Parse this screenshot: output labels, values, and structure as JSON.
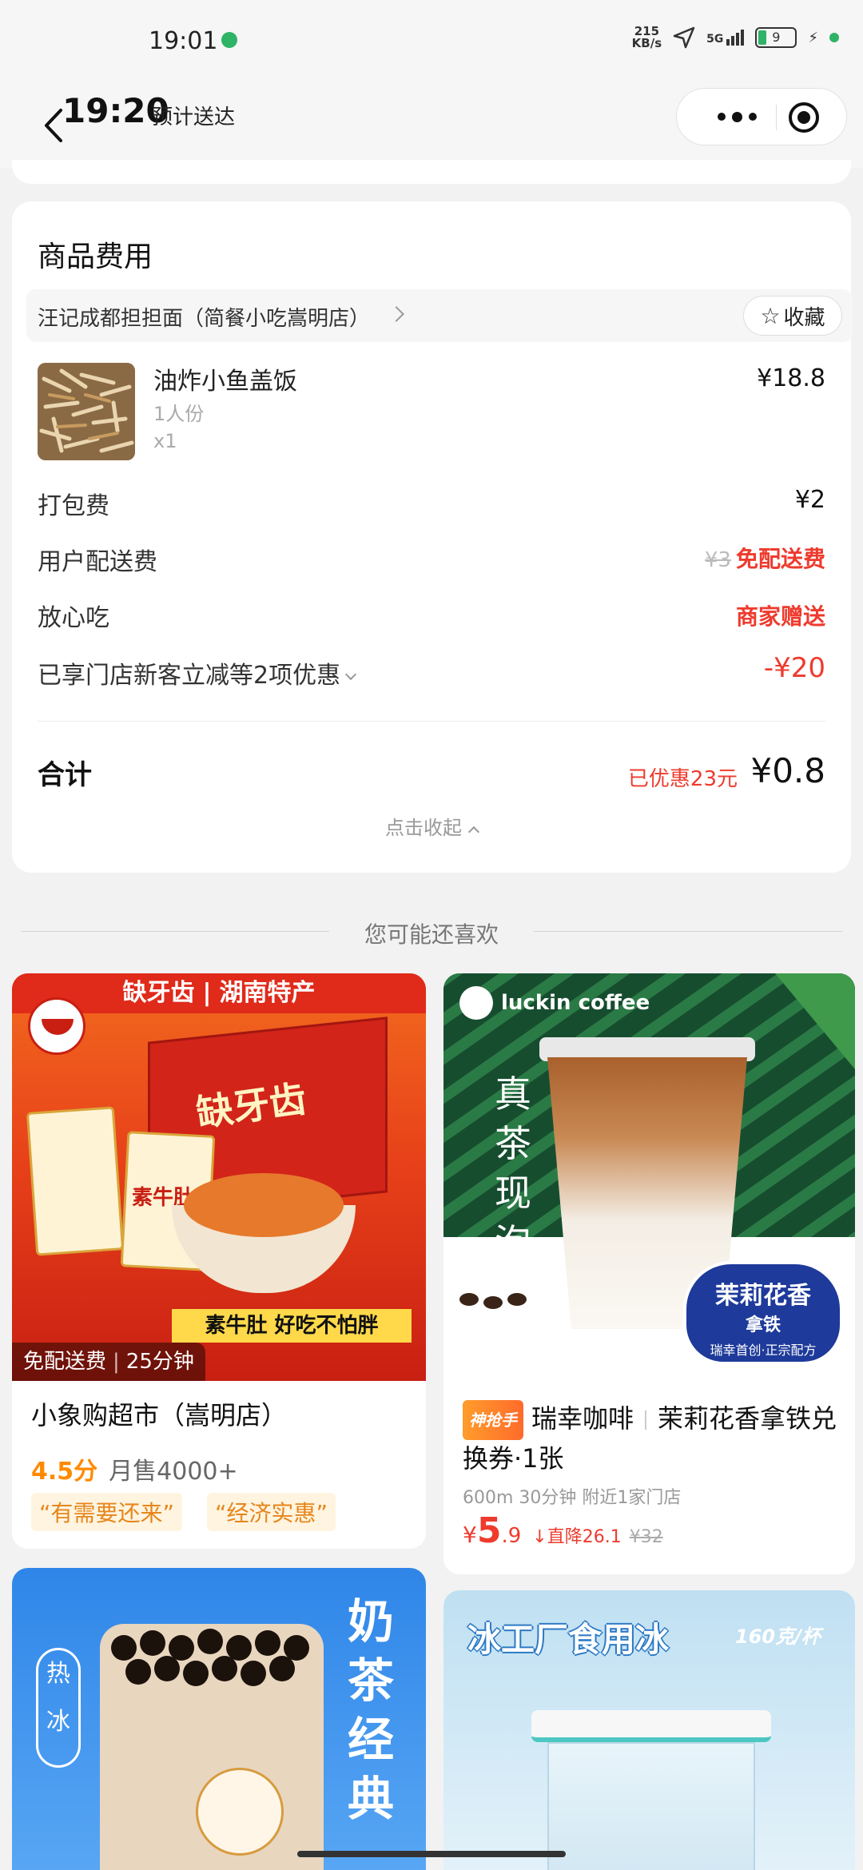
{
  "status_bar": {
    "time": "19:01",
    "speed_value": "215",
    "speed_unit": "KB/s",
    "network": "5G",
    "battery": "9"
  },
  "header": {
    "eta_time": "19:20",
    "eta_label": "预计送达"
  },
  "fees": {
    "title": "商品费用",
    "shop_name": "汪记成都担担面（简餐小吃嵩明店）",
    "favorite_label": "收藏",
    "item": {
      "name": "油炸小鱼盖饭",
      "portion": "1人份",
      "quantity": "x1",
      "price": "¥18.8"
    },
    "packing_label": "打包费",
    "packing_value": "¥2",
    "delivery_label": "用户配送费",
    "delivery_original": "¥3",
    "delivery_value": "免配送费",
    "safe_label": "放心吃",
    "safe_value": "商家赠送",
    "discount_label": "已享门店新客立减等2项优惠",
    "discount_value": "-¥20",
    "total_label": "合计",
    "total_saved": "已优惠23元",
    "total_value": "¥0.8",
    "collapse_label": "点击收起"
  },
  "recommend": {
    "section_title": "您可能还喜欢",
    "cards": [
      {
        "banner_brand": "缺牙齿",
        "banner_region": "湖南特产",
        "product_label": "素牛肚",
        "slogan": "素牛肚  好吃不怕胖",
        "overlay_delivery": "免配送费",
        "overlay_time": "25分钟",
        "title": "小象购超市（嵩明店）",
        "score": "4.5分",
        "sales": "月售4000+",
        "tags": [
          "“有需要还来”",
          "“经济实惠”"
        ]
      },
      {
        "brand_logo_text": "luckin coffee",
        "poster_vertical_text": "真茶现泡",
        "badge_title": "茉莉花香",
        "badge_sub": "拿铁",
        "badge_foot": "瑞幸首创·正宗配方",
        "promo_label": "神抢手",
        "shop": "瑞幸咖啡",
        "title": "茉莉花香拿铁兑换券·1张",
        "meta": "600m 30分钟  附近1家门店",
        "price_symbol": "¥",
        "price_int": "5",
        "price_dec": ".9",
        "price_drop": "直降26.1",
        "price_was": "¥32"
      },
      {
        "poster_text": "奶茶经典",
        "badge_top": "热",
        "badge_bottom": "冰"
      },
      {
        "poster_title": "冰工厂食用冰",
        "poster_sub": "160克/杯"
      }
    ]
  },
  "colors": {
    "accent_red": "#ee3b2e",
    "orange": "#ff8a00",
    "green": "#2fb366"
  }
}
